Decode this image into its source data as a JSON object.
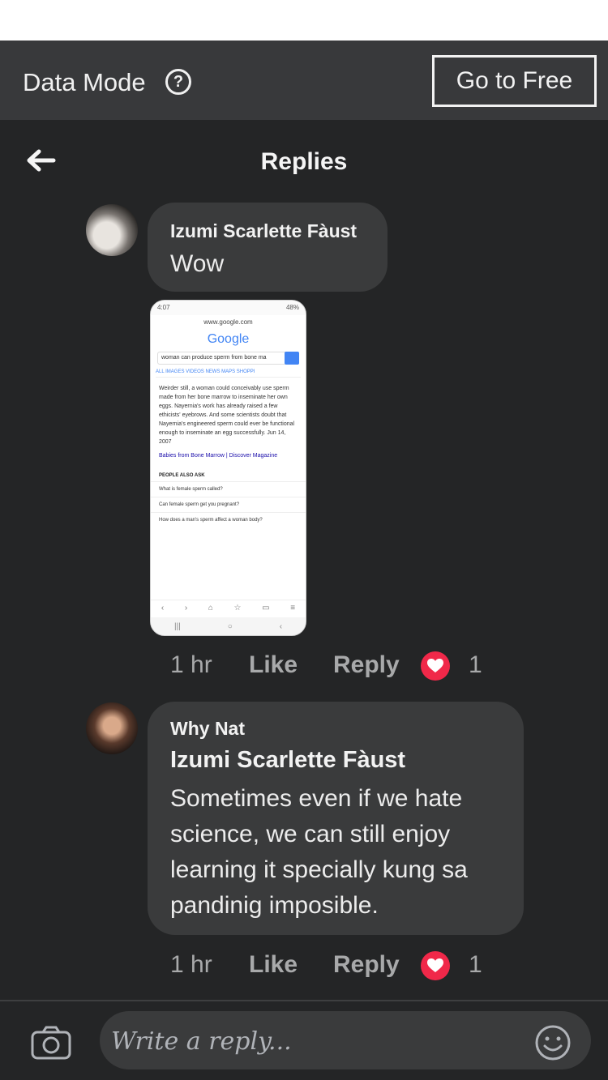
{
  "data_bar": {
    "label": "Data Mode",
    "help_glyph": "?",
    "go_free_label": "Go to Free"
  },
  "header": {
    "title": "Replies",
    "back_icon": "arrow-left-icon"
  },
  "comments": [
    {
      "author": "Izumi Scarlette Fàust",
      "text": "Wow",
      "attachment": {
        "status_left": "4:07",
        "status_right": "48%",
        "url": "www.google.com",
        "logo": "Google",
        "query": "woman can produce sperm from bone ma",
        "tabs": "ALL   IMAGES   VIDEOS   NEWS   MAPS   SHOPPI",
        "snippet": "Weirder still, a woman could conceivably use sperm made from her bone marrow to inseminate her own eggs. Nayernia's work has already raised a few ethicists' eyebrows. And some scientists doubt that Nayernia's engineered sperm could ever be functional enough to inseminate an egg successfully. Jun 14, 2007",
        "link_title": "Babies from Bone Marrow | Discover Magazine",
        "paa_title": "PEOPLE ALSO ASK",
        "questions": [
          "What is female sperm called?",
          "Can female sperm get you pregnant?",
          "How does a man's sperm affect a woman body?"
        ]
      },
      "time": "1 hr",
      "like_label": "Like",
      "reply_label": "Reply",
      "reaction_count": "1"
    },
    {
      "author": "Why Nat",
      "mention": "Izumi Scarlette Fàust",
      "text_lines": [
        "Sometimes even if we hate",
        "science, we can still enjoy",
        "learning it specially kung sa",
        "pandinig imposible."
      ],
      "time": "1 hr",
      "like_label": "Like",
      "reply_label": "Reply",
      "reaction_count": "1"
    }
  ],
  "composer": {
    "placeholder": "Write a reply...",
    "camera_icon": "camera-icon",
    "emoji_icon": "smiley-icon"
  },
  "colors": {
    "background": "#242526",
    "bubble": "#3a3b3c",
    "data_bar": "#38393b",
    "heart": "#f02849"
  }
}
